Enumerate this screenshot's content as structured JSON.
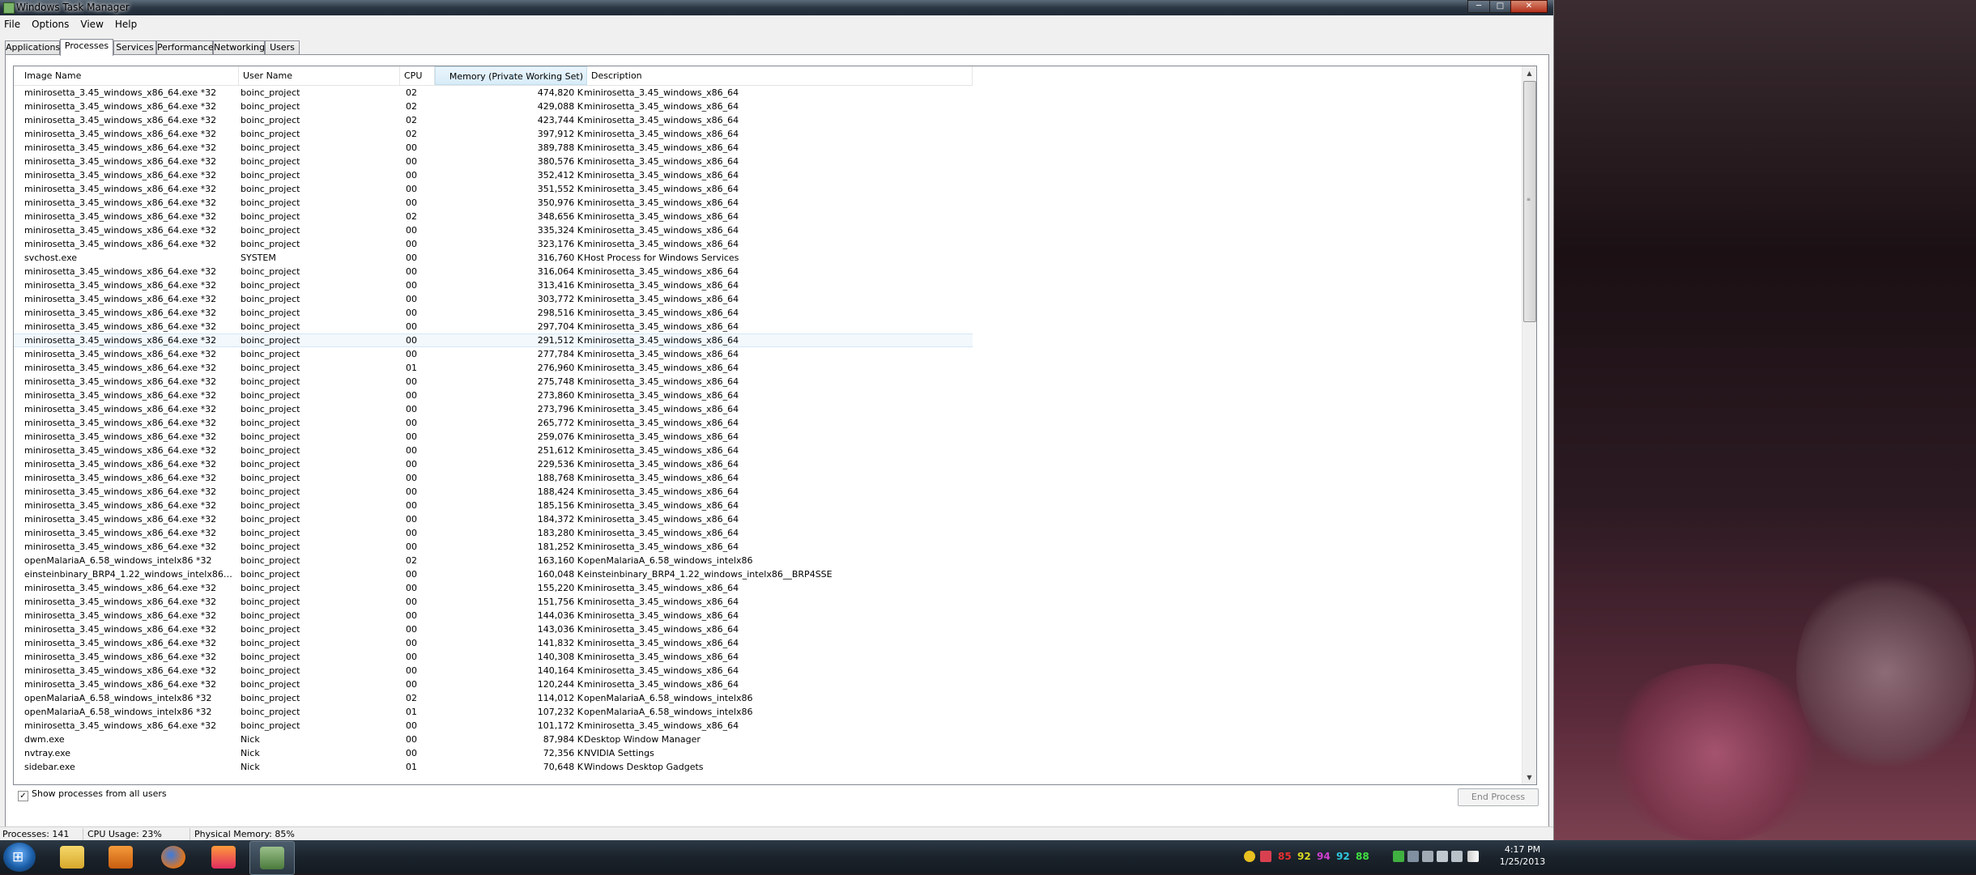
{
  "window": {
    "title": "Windows Task Manager",
    "controls": {
      "minimize": "─",
      "maximize": "□",
      "close": "✕"
    }
  },
  "menu": [
    "File",
    "Options",
    "View",
    "Help"
  ],
  "tabs": [
    "Applications",
    "Processes",
    "Services",
    "Performance",
    "Networking",
    "Users"
  ],
  "active_tab": "Processes",
  "columns": [
    "Image Name",
    "User Name",
    "CPU",
    "Memory (Private Working Set)",
    "Description"
  ],
  "rows": [
    [
      "minirosetta_3.45_windows_x86_64.exe *32",
      "boinc_project",
      "02",
      "474,820 K",
      "minirosetta_3.45_windows_x86_64"
    ],
    [
      "minirosetta_3.45_windows_x86_64.exe *32",
      "boinc_project",
      "02",
      "429,088 K",
      "minirosetta_3.45_windows_x86_64"
    ],
    [
      "minirosetta_3.45_windows_x86_64.exe *32",
      "boinc_project",
      "02",
      "423,744 K",
      "minirosetta_3.45_windows_x86_64"
    ],
    [
      "minirosetta_3.45_windows_x86_64.exe *32",
      "boinc_project",
      "02",
      "397,912 K",
      "minirosetta_3.45_windows_x86_64"
    ],
    [
      "minirosetta_3.45_windows_x86_64.exe *32",
      "boinc_project",
      "00",
      "389,788 K",
      "minirosetta_3.45_windows_x86_64"
    ],
    [
      "minirosetta_3.45_windows_x86_64.exe *32",
      "boinc_project",
      "00",
      "380,576 K",
      "minirosetta_3.45_windows_x86_64"
    ],
    [
      "minirosetta_3.45_windows_x86_64.exe *32",
      "boinc_project",
      "00",
      "352,412 K",
      "minirosetta_3.45_windows_x86_64"
    ],
    [
      "minirosetta_3.45_windows_x86_64.exe *32",
      "boinc_project",
      "00",
      "351,552 K",
      "minirosetta_3.45_windows_x86_64"
    ],
    [
      "minirosetta_3.45_windows_x86_64.exe *32",
      "boinc_project",
      "00",
      "350,976 K",
      "minirosetta_3.45_windows_x86_64"
    ],
    [
      "minirosetta_3.45_windows_x86_64.exe *32",
      "boinc_project",
      "02",
      "348,656 K",
      "minirosetta_3.45_windows_x86_64"
    ],
    [
      "minirosetta_3.45_windows_x86_64.exe *32",
      "boinc_project",
      "00",
      "335,324 K",
      "minirosetta_3.45_windows_x86_64"
    ],
    [
      "minirosetta_3.45_windows_x86_64.exe *32",
      "boinc_project",
      "00",
      "323,176 K",
      "minirosetta_3.45_windows_x86_64"
    ],
    [
      "svchost.exe",
      "SYSTEM",
      "00",
      "316,760 K",
      "Host Process for Windows Services"
    ],
    [
      "minirosetta_3.45_windows_x86_64.exe *32",
      "boinc_project",
      "00",
      "316,064 K",
      "minirosetta_3.45_windows_x86_64"
    ],
    [
      "minirosetta_3.45_windows_x86_64.exe *32",
      "boinc_project",
      "00",
      "313,416 K",
      "minirosetta_3.45_windows_x86_64"
    ],
    [
      "minirosetta_3.45_windows_x86_64.exe *32",
      "boinc_project",
      "00",
      "303,772 K",
      "minirosetta_3.45_windows_x86_64"
    ],
    [
      "minirosetta_3.45_windows_x86_64.exe *32",
      "boinc_project",
      "00",
      "298,516 K",
      "minirosetta_3.45_windows_x86_64"
    ],
    [
      "minirosetta_3.45_windows_x86_64.exe *32",
      "boinc_project",
      "00",
      "297,704 K",
      "minirosetta_3.45_windows_x86_64"
    ],
    [
      "minirosetta_3.45_windows_x86_64.exe *32",
      "boinc_project",
      "00",
      "291,512 K",
      "minirosetta_3.45_windows_x86_64"
    ],
    [
      "minirosetta_3.45_windows_x86_64.exe *32",
      "boinc_project",
      "00",
      "277,784 K",
      "minirosetta_3.45_windows_x86_64"
    ],
    [
      "minirosetta_3.45_windows_x86_64.exe *32",
      "boinc_project",
      "01",
      "276,960 K",
      "minirosetta_3.45_windows_x86_64"
    ],
    [
      "minirosetta_3.45_windows_x86_64.exe *32",
      "boinc_project",
      "00",
      "275,748 K",
      "minirosetta_3.45_windows_x86_64"
    ],
    [
      "minirosetta_3.45_windows_x86_64.exe *32",
      "boinc_project",
      "00",
      "273,860 K",
      "minirosetta_3.45_windows_x86_64"
    ],
    [
      "minirosetta_3.45_windows_x86_64.exe *32",
      "boinc_project",
      "00",
      "273,796 K",
      "minirosetta_3.45_windows_x86_64"
    ],
    [
      "minirosetta_3.45_windows_x86_64.exe *32",
      "boinc_project",
      "00",
      "265,772 K",
      "minirosetta_3.45_windows_x86_64"
    ],
    [
      "minirosetta_3.45_windows_x86_64.exe *32",
      "boinc_project",
      "00",
      "259,076 K",
      "minirosetta_3.45_windows_x86_64"
    ],
    [
      "minirosetta_3.45_windows_x86_64.exe *32",
      "boinc_project",
      "00",
      "251,612 K",
      "minirosetta_3.45_windows_x86_64"
    ],
    [
      "minirosetta_3.45_windows_x86_64.exe *32",
      "boinc_project",
      "00",
      "229,536 K",
      "minirosetta_3.45_windows_x86_64"
    ],
    [
      "minirosetta_3.45_windows_x86_64.exe *32",
      "boinc_project",
      "00",
      "188,768 K",
      "minirosetta_3.45_windows_x86_64"
    ],
    [
      "minirosetta_3.45_windows_x86_64.exe *32",
      "boinc_project",
      "00",
      "188,424 K",
      "minirosetta_3.45_windows_x86_64"
    ],
    [
      "minirosetta_3.45_windows_x86_64.exe *32",
      "boinc_project",
      "00",
      "185,156 K",
      "minirosetta_3.45_windows_x86_64"
    ],
    [
      "minirosetta_3.45_windows_x86_64.exe *32",
      "boinc_project",
      "00",
      "184,372 K",
      "minirosetta_3.45_windows_x86_64"
    ],
    [
      "minirosetta_3.45_windows_x86_64.exe *32",
      "boinc_project",
      "00",
      "183,280 K",
      "minirosetta_3.45_windows_x86_64"
    ],
    [
      "minirosetta_3.45_windows_x86_64.exe *32",
      "boinc_project",
      "00",
      "181,252 K",
      "minirosetta_3.45_windows_x86_64"
    ],
    [
      "openMalariaA_6.58_windows_intelx86 *32",
      "boinc_project",
      "02",
      "163,160 K",
      "openMalariaA_6.58_windows_intelx86"
    ],
    [
      "einsteinbinary_BRP4_1.22_windows_intelx86__BR...",
      "boinc_project",
      "00",
      "160,048 K",
      "einsteinbinary_BRP4_1.22_windows_intelx86__BRP4SSE"
    ],
    [
      "minirosetta_3.45_windows_x86_64.exe *32",
      "boinc_project",
      "00",
      "155,220 K",
      "minirosetta_3.45_windows_x86_64"
    ],
    [
      "minirosetta_3.45_windows_x86_64.exe *32",
      "boinc_project",
      "00",
      "151,756 K",
      "minirosetta_3.45_windows_x86_64"
    ],
    [
      "minirosetta_3.45_windows_x86_64.exe *32",
      "boinc_project",
      "00",
      "144,036 K",
      "minirosetta_3.45_windows_x86_64"
    ],
    [
      "minirosetta_3.45_windows_x86_64.exe *32",
      "boinc_project",
      "00",
      "143,036 K",
      "minirosetta_3.45_windows_x86_64"
    ],
    [
      "minirosetta_3.45_windows_x86_64.exe *32",
      "boinc_project",
      "00",
      "141,832 K",
      "minirosetta_3.45_windows_x86_64"
    ],
    [
      "minirosetta_3.45_windows_x86_64.exe *32",
      "boinc_project",
      "00",
      "140,308 K",
      "minirosetta_3.45_windows_x86_64"
    ],
    [
      "minirosetta_3.45_windows_x86_64.exe *32",
      "boinc_project",
      "00",
      "140,164 K",
      "minirosetta_3.45_windows_x86_64"
    ],
    [
      "minirosetta_3.45_windows_x86_64.exe *32",
      "boinc_project",
      "00",
      "120,244 K",
      "minirosetta_3.45_windows_x86_64"
    ],
    [
      "openMalariaA_6.58_windows_intelx86 *32",
      "boinc_project",
      "02",
      "114,012 K",
      "openMalariaA_6.58_windows_intelx86"
    ],
    [
      "openMalariaA_6.58_windows_intelx86 *32",
      "boinc_project",
      "01",
      "107,232 K",
      "openMalariaA_6.58_windows_intelx86"
    ],
    [
      "minirosetta_3.45_windows_x86_64.exe *32",
      "boinc_project",
      "00",
      "101,172 K",
      "minirosetta_3.45_windows_x86_64"
    ],
    [
      "dwm.exe",
      "Nick",
      "00",
      "87,984 K",
      "Desktop Window Manager"
    ],
    [
      "nvtray.exe",
      "Nick",
      "00",
      "72,356 K",
      "NVIDIA Settings"
    ],
    [
      "sidebar.exe",
      "Nick",
      "01",
      "70,648 K",
      "Windows Desktop Gadgets"
    ]
  ],
  "selected_row_index": 18,
  "show_all_label": "Show processes from all users",
  "show_all_checked": true,
  "end_process_label": "End Process",
  "status": {
    "processes": "Processes: 141",
    "cpu": "CPU Usage: 23%",
    "memory": "Physical Memory: 85%"
  },
  "tray": {
    "temps": [
      "85",
      "92",
      "94",
      "92",
      "88"
    ],
    "temp_colors": [
      "#e83030",
      "#d8d820",
      "#d040d0",
      "#30c8e0",
      "#40e040"
    ],
    "time": "4:17 PM",
    "date": "1/25/2013"
  },
  "icons": {
    "start": "windows-flag-icon",
    "explorer": "folder-icon",
    "media": "media-player-icon",
    "firefox": "firefox-icon",
    "flame": "flame-app-icon",
    "taskmgr": "task-manager-icon"
  }
}
